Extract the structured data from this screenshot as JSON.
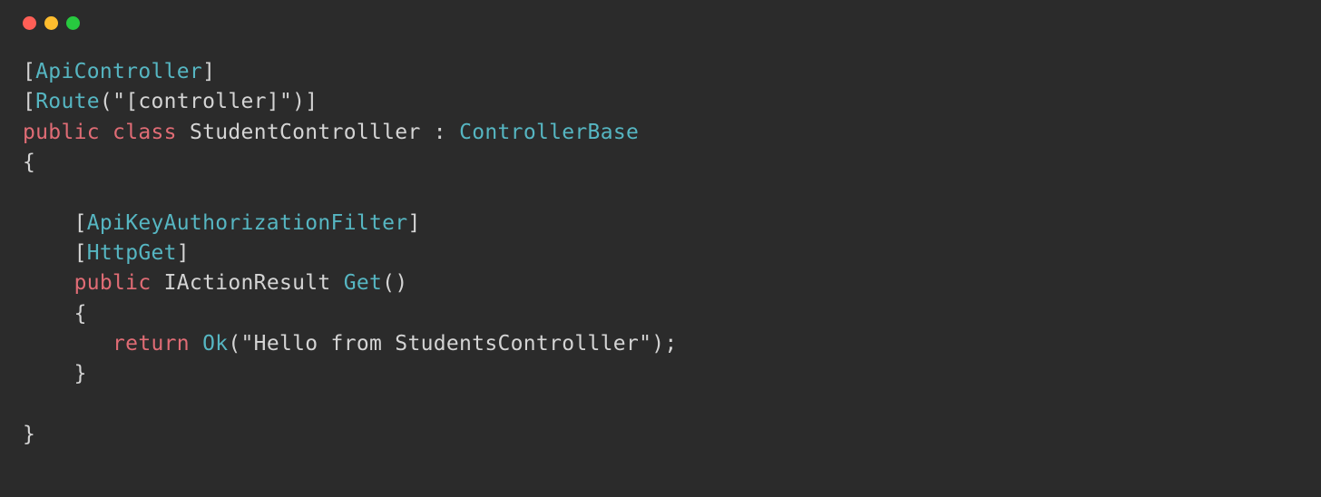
{
  "titlebar": {
    "close": "close",
    "minimize": "minimize",
    "maximize": "maximize"
  },
  "code": {
    "line1": {
      "b1": "[",
      "attr1": "ApiController",
      "b2": "]"
    },
    "line2": {
      "b1": "[",
      "attr": "Route",
      "paren1": "(",
      "str": "\"[controller]\"",
      "paren2": ")",
      "b2": "]"
    },
    "line3": {
      "kw1": "public",
      "sp1": " ",
      "kw2": "class",
      "sp2": " ",
      "name": "StudentControlller",
      "sp3": " ",
      "colon": ":",
      "sp4": " ",
      "base": "ControllerBase"
    },
    "line4": "{",
    "line5": " ",
    "line6": {
      "indent": "    ",
      "b1": "[",
      "attr": "ApiKeyAuthorizationFilter",
      "b2": "]"
    },
    "line7": {
      "indent": "    ",
      "b1": "[",
      "attr": "HttpGet",
      "b2": "]"
    },
    "line8": {
      "indent": "    ",
      "kw": "public",
      "sp1": " ",
      "ret": "IActionResult",
      "sp2": " ",
      "name": "Get",
      "parens": "()"
    },
    "line9": {
      "indent": "    ",
      "brace": "{"
    },
    "line10": {
      "indent": "       ",
      "kw": "return",
      "sp1": " ",
      "fn": "Ok",
      "paren1": "(",
      "str": "\"Hello from StudentsControlller\"",
      "paren2": ")",
      "semi": ";"
    },
    "line11": {
      "indent": "    ",
      "brace": "}"
    },
    "line12": " ",
    "line13": "}"
  }
}
